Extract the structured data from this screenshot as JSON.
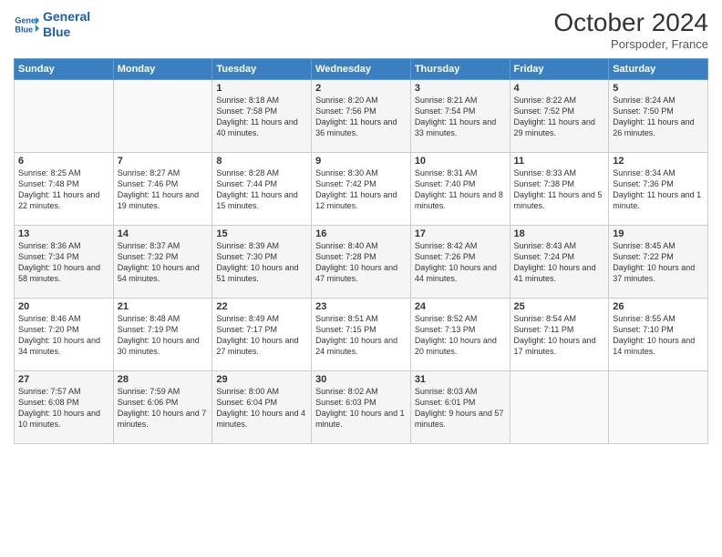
{
  "logo": {
    "line1": "General",
    "line2": "Blue"
  },
  "title": "October 2024",
  "location": "Porspoder, France",
  "days_of_week": [
    "Sunday",
    "Monday",
    "Tuesday",
    "Wednesday",
    "Thursday",
    "Friday",
    "Saturday"
  ],
  "weeks": [
    [
      {
        "day": "",
        "sunrise": "",
        "sunset": "",
        "daylight": ""
      },
      {
        "day": "",
        "sunrise": "",
        "sunset": "",
        "daylight": ""
      },
      {
        "day": "1",
        "sunrise": "Sunrise: 8:18 AM",
        "sunset": "Sunset: 7:58 PM",
        "daylight": "Daylight: 11 hours and 40 minutes."
      },
      {
        "day": "2",
        "sunrise": "Sunrise: 8:20 AM",
        "sunset": "Sunset: 7:56 PM",
        "daylight": "Daylight: 11 hours and 36 minutes."
      },
      {
        "day": "3",
        "sunrise": "Sunrise: 8:21 AM",
        "sunset": "Sunset: 7:54 PM",
        "daylight": "Daylight: 11 hours and 33 minutes."
      },
      {
        "day": "4",
        "sunrise": "Sunrise: 8:22 AM",
        "sunset": "Sunset: 7:52 PM",
        "daylight": "Daylight: 11 hours and 29 minutes."
      },
      {
        "day": "5",
        "sunrise": "Sunrise: 8:24 AM",
        "sunset": "Sunset: 7:50 PM",
        "daylight": "Daylight: 11 hours and 26 minutes."
      }
    ],
    [
      {
        "day": "6",
        "sunrise": "Sunrise: 8:25 AM",
        "sunset": "Sunset: 7:48 PM",
        "daylight": "Daylight: 11 hours and 22 minutes."
      },
      {
        "day": "7",
        "sunrise": "Sunrise: 8:27 AM",
        "sunset": "Sunset: 7:46 PM",
        "daylight": "Daylight: 11 hours and 19 minutes."
      },
      {
        "day": "8",
        "sunrise": "Sunrise: 8:28 AM",
        "sunset": "Sunset: 7:44 PM",
        "daylight": "Daylight: 11 hours and 15 minutes."
      },
      {
        "day": "9",
        "sunrise": "Sunrise: 8:30 AM",
        "sunset": "Sunset: 7:42 PM",
        "daylight": "Daylight: 11 hours and 12 minutes."
      },
      {
        "day": "10",
        "sunrise": "Sunrise: 8:31 AM",
        "sunset": "Sunset: 7:40 PM",
        "daylight": "Daylight: 11 hours and 8 minutes."
      },
      {
        "day": "11",
        "sunrise": "Sunrise: 8:33 AM",
        "sunset": "Sunset: 7:38 PM",
        "daylight": "Daylight: 11 hours and 5 minutes."
      },
      {
        "day": "12",
        "sunrise": "Sunrise: 8:34 AM",
        "sunset": "Sunset: 7:36 PM",
        "daylight": "Daylight: 11 hours and 1 minute."
      }
    ],
    [
      {
        "day": "13",
        "sunrise": "Sunrise: 8:36 AM",
        "sunset": "Sunset: 7:34 PM",
        "daylight": "Daylight: 10 hours and 58 minutes."
      },
      {
        "day": "14",
        "sunrise": "Sunrise: 8:37 AM",
        "sunset": "Sunset: 7:32 PM",
        "daylight": "Daylight: 10 hours and 54 minutes."
      },
      {
        "day": "15",
        "sunrise": "Sunrise: 8:39 AM",
        "sunset": "Sunset: 7:30 PM",
        "daylight": "Daylight: 10 hours and 51 minutes."
      },
      {
        "day": "16",
        "sunrise": "Sunrise: 8:40 AM",
        "sunset": "Sunset: 7:28 PM",
        "daylight": "Daylight: 10 hours and 47 minutes."
      },
      {
        "day": "17",
        "sunrise": "Sunrise: 8:42 AM",
        "sunset": "Sunset: 7:26 PM",
        "daylight": "Daylight: 10 hours and 44 minutes."
      },
      {
        "day": "18",
        "sunrise": "Sunrise: 8:43 AM",
        "sunset": "Sunset: 7:24 PM",
        "daylight": "Daylight: 10 hours and 41 minutes."
      },
      {
        "day": "19",
        "sunrise": "Sunrise: 8:45 AM",
        "sunset": "Sunset: 7:22 PM",
        "daylight": "Daylight: 10 hours and 37 minutes."
      }
    ],
    [
      {
        "day": "20",
        "sunrise": "Sunrise: 8:46 AM",
        "sunset": "Sunset: 7:20 PM",
        "daylight": "Daylight: 10 hours and 34 minutes."
      },
      {
        "day": "21",
        "sunrise": "Sunrise: 8:48 AM",
        "sunset": "Sunset: 7:19 PM",
        "daylight": "Daylight: 10 hours and 30 minutes."
      },
      {
        "day": "22",
        "sunrise": "Sunrise: 8:49 AM",
        "sunset": "Sunset: 7:17 PM",
        "daylight": "Daylight: 10 hours and 27 minutes."
      },
      {
        "day": "23",
        "sunrise": "Sunrise: 8:51 AM",
        "sunset": "Sunset: 7:15 PM",
        "daylight": "Daylight: 10 hours and 24 minutes."
      },
      {
        "day": "24",
        "sunrise": "Sunrise: 8:52 AM",
        "sunset": "Sunset: 7:13 PM",
        "daylight": "Daylight: 10 hours and 20 minutes."
      },
      {
        "day": "25",
        "sunrise": "Sunrise: 8:54 AM",
        "sunset": "Sunset: 7:11 PM",
        "daylight": "Daylight: 10 hours and 17 minutes."
      },
      {
        "day": "26",
        "sunrise": "Sunrise: 8:55 AM",
        "sunset": "Sunset: 7:10 PM",
        "daylight": "Daylight: 10 hours and 14 minutes."
      }
    ],
    [
      {
        "day": "27",
        "sunrise": "Sunrise: 7:57 AM",
        "sunset": "Sunset: 6:08 PM",
        "daylight": "Daylight: 10 hours and 10 minutes."
      },
      {
        "day": "28",
        "sunrise": "Sunrise: 7:59 AM",
        "sunset": "Sunset: 6:06 PM",
        "daylight": "Daylight: 10 hours and 7 minutes."
      },
      {
        "day": "29",
        "sunrise": "Sunrise: 8:00 AM",
        "sunset": "Sunset: 6:04 PM",
        "daylight": "Daylight: 10 hours and 4 minutes."
      },
      {
        "day": "30",
        "sunrise": "Sunrise: 8:02 AM",
        "sunset": "Sunset: 6:03 PM",
        "daylight": "Daylight: 10 hours and 1 minute."
      },
      {
        "day": "31",
        "sunrise": "Sunrise: 8:03 AM",
        "sunset": "Sunset: 6:01 PM",
        "daylight": "Daylight: 9 hours and 57 minutes."
      },
      {
        "day": "",
        "sunrise": "",
        "sunset": "",
        "daylight": ""
      },
      {
        "day": "",
        "sunrise": "",
        "sunset": "",
        "daylight": ""
      }
    ]
  ]
}
